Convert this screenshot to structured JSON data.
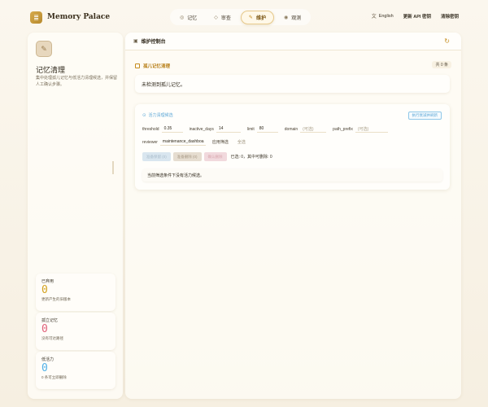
{
  "app": {
    "name": "Memory Palace",
    "logo_glyph": "≣"
  },
  "nav": {
    "tabs": [
      {
        "label": "记忆",
        "icon": "database-icon",
        "glyph": "◎"
      },
      {
        "label": "审查",
        "icon": "shield-icon",
        "glyph": "◇"
      },
      {
        "label": "维护",
        "icon": "feather-icon",
        "glyph": "✎"
      },
      {
        "label": "观测",
        "icon": "eye-icon",
        "glyph": "◉"
      }
    ],
    "active": "维护"
  },
  "header": {
    "language": "English",
    "update_api_key": "更新 API 密钥",
    "clear_key": "清除密钥"
  },
  "sidebar": {
    "title": "记忆清理",
    "description": "集中处理孤儿记忆与低活力清理候选，并保留人工确认步骤。",
    "stats": [
      {
        "label": "已弃用",
        "value": "0",
        "sub": "更新产生的旧版本",
        "color": "#d3a21e"
      },
      {
        "label": "孤立记忆",
        "value": "0",
        "sub": "没有可达路径",
        "color": "#e0617a"
      },
      {
        "label": "低活力",
        "value": "0",
        "sub": "0 条可立即删除",
        "color": "#4fb0e8"
      }
    ]
  },
  "main": {
    "title": "维护控制台",
    "orphans": {
      "title": "孤儿记忆清理",
      "count": "共 0 条",
      "empty": "未检测到孤儿记忆。"
    },
    "vitality": {
      "title": "活力清理候选",
      "refresh_button": "执行衰减并刷新",
      "filters": {
        "threshold_label": "threshold",
        "threshold": "0.35",
        "inactive_days_label": "inactive_days",
        "inactive_days": "14",
        "limit_label": "limit",
        "limit": "80",
        "domain_label": "domain",
        "domain_placeholder": "(可选)",
        "path_prefix_label": "path_prefix",
        "path_prefix_placeholder": "(可选)",
        "reviewer_label": "reviewer",
        "reviewer": "maintenance_dashboa",
        "apply": "应用筛选",
        "select_all": "全选"
      },
      "actions": {
        "keep": "准备保留 (0)",
        "delete": "准备删除 (0)",
        "confirm": "确认删除",
        "status": "已选: 0，其中可删除: 0"
      },
      "empty": "当前筛选条件下没有活力候选。"
    }
  }
}
